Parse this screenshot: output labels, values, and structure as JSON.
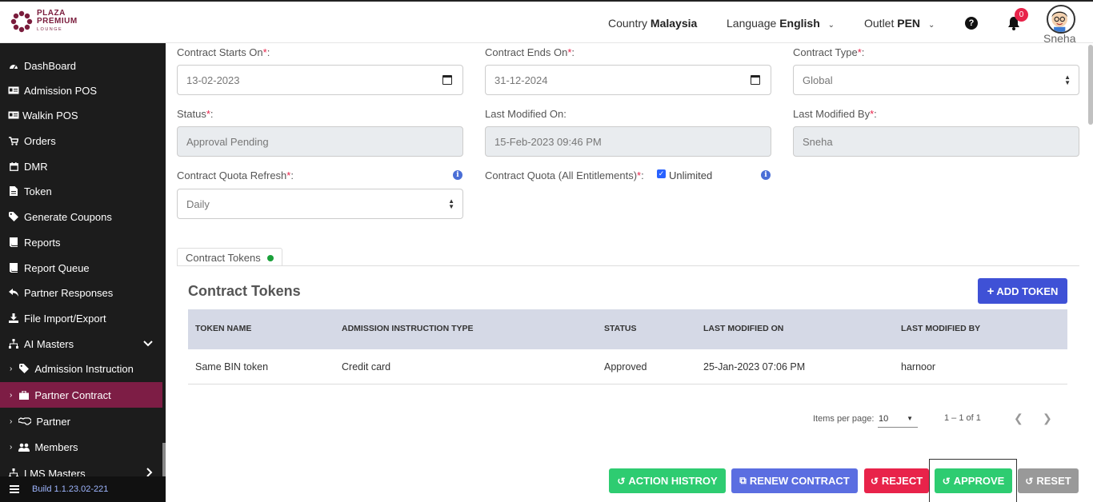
{
  "header": {
    "logo": {
      "line1": "PLAZA",
      "line2": "PREMIUM",
      "line3": "LOUNGE"
    },
    "country_label": "Country",
    "country_value": "Malaysia",
    "language_label": "Language",
    "language_value": "English",
    "outlet_label": "Outlet",
    "outlet_value": "PEN",
    "notification_count": "0",
    "user_name": "Sneha"
  },
  "sidebar": {
    "items": [
      {
        "label": "DashBoard",
        "icon": "dashboard-icon"
      },
      {
        "label": "Admission POS",
        "icon": "id-card-icon"
      },
      {
        "label": "Walkin POS",
        "icon": "id-card-icon"
      },
      {
        "label": "Orders",
        "icon": "cart-icon"
      },
      {
        "label": "DMR",
        "icon": "calendar-icon"
      },
      {
        "label": "Token",
        "icon": "file-icon"
      },
      {
        "label": "Generate Coupons",
        "icon": "tag-icon"
      },
      {
        "label": "Reports",
        "icon": "book-icon"
      },
      {
        "label": "Report Queue",
        "icon": "book-icon"
      },
      {
        "label": "Partner Responses",
        "icon": "reply-icon"
      },
      {
        "label": "File Import/Export",
        "icon": "download-icon"
      },
      {
        "label": "AI Masters",
        "icon": "sitemap-icon"
      },
      {
        "label": "Admission Instruction",
        "icon": "tag-icon"
      },
      {
        "label": "Partner Contract",
        "icon": "briefcase-icon"
      },
      {
        "label": "Partner",
        "icon": "handshake-icon"
      },
      {
        "label": "Members",
        "icon": "users-icon"
      },
      {
        "label": "LMS Masters",
        "icon": "sitemap-icon"
      }
    ],
    "build": "Build 1.1.23.02-221"
  },
  "form": {
    "contract_starts_label": "Contract Starts On",
    "contract_starts_value": "13-02-2023",
    "contract_ends_label": "Contract Ends On",
    "contract_ends_value": "31-12-2024",
    "contract_type_label": "Contract Type",
    "contract_type_value": "Global",
    "status_label": "Status",
    "status_value": "Approval Pending",
    "last_modified_on_label": "Last Modified On",
    "last_modified_on_value": "15-Feb-2023 09:46 PM",
    "last_modified_by_label": "Last Modified By",
    "last_modified_by_value": "Sneha",
    "quota_refresh_label": "Contract Quota Refresh",
    "quota_refresh_value": "Daily",
    "quota_all_label": "Contract Quota (All Entitlements)",
    "unlimited_label": "Unlimited",
    "required_mark": "*",
    "colon": ":"
  },
  "tabs": [
    {
      "label": "Contract Tokens"
    }
  ],
  "tokens": {
    "title": "Contract Tokens",
    "add_button": "ADD TOKEN",
    "columns": [
      "TOKEN NAME",
      "ADMISSION INSTRUCTION TYPE",
      "STATUS",
      "LAST MODIFIED ON",
      "LAST MODIFIED BY"
    ],
    "rows": [
      [
        "Same BIN token",
        "Credit card",
        "Approved",
        "25-Jan-2023 07:06 PM",
        "harnoor"
      ]
    ],
    "items_per_page_label": "Items per page:",
    "items_per_page_value": "10",
    "range": "1 – 1 of 1"
  },
  "actions": {
    "action_history": "ACTION HISTROY",
    "renew_contract": "RENEW CONTRACT",
    "reject": "REJECT",
    "approve": "APPROVE",
    "reset": "RESET"
  },
  "colors": {
    "sidebar_bg": "#1c1c1c",
    "sidebar_active": "#7d1d45",
    "primary": "#3f51d6",
    "success": "#2ecc71",
    "danger": "#e8234a",
    "secondary": "#999999"
  }
}
